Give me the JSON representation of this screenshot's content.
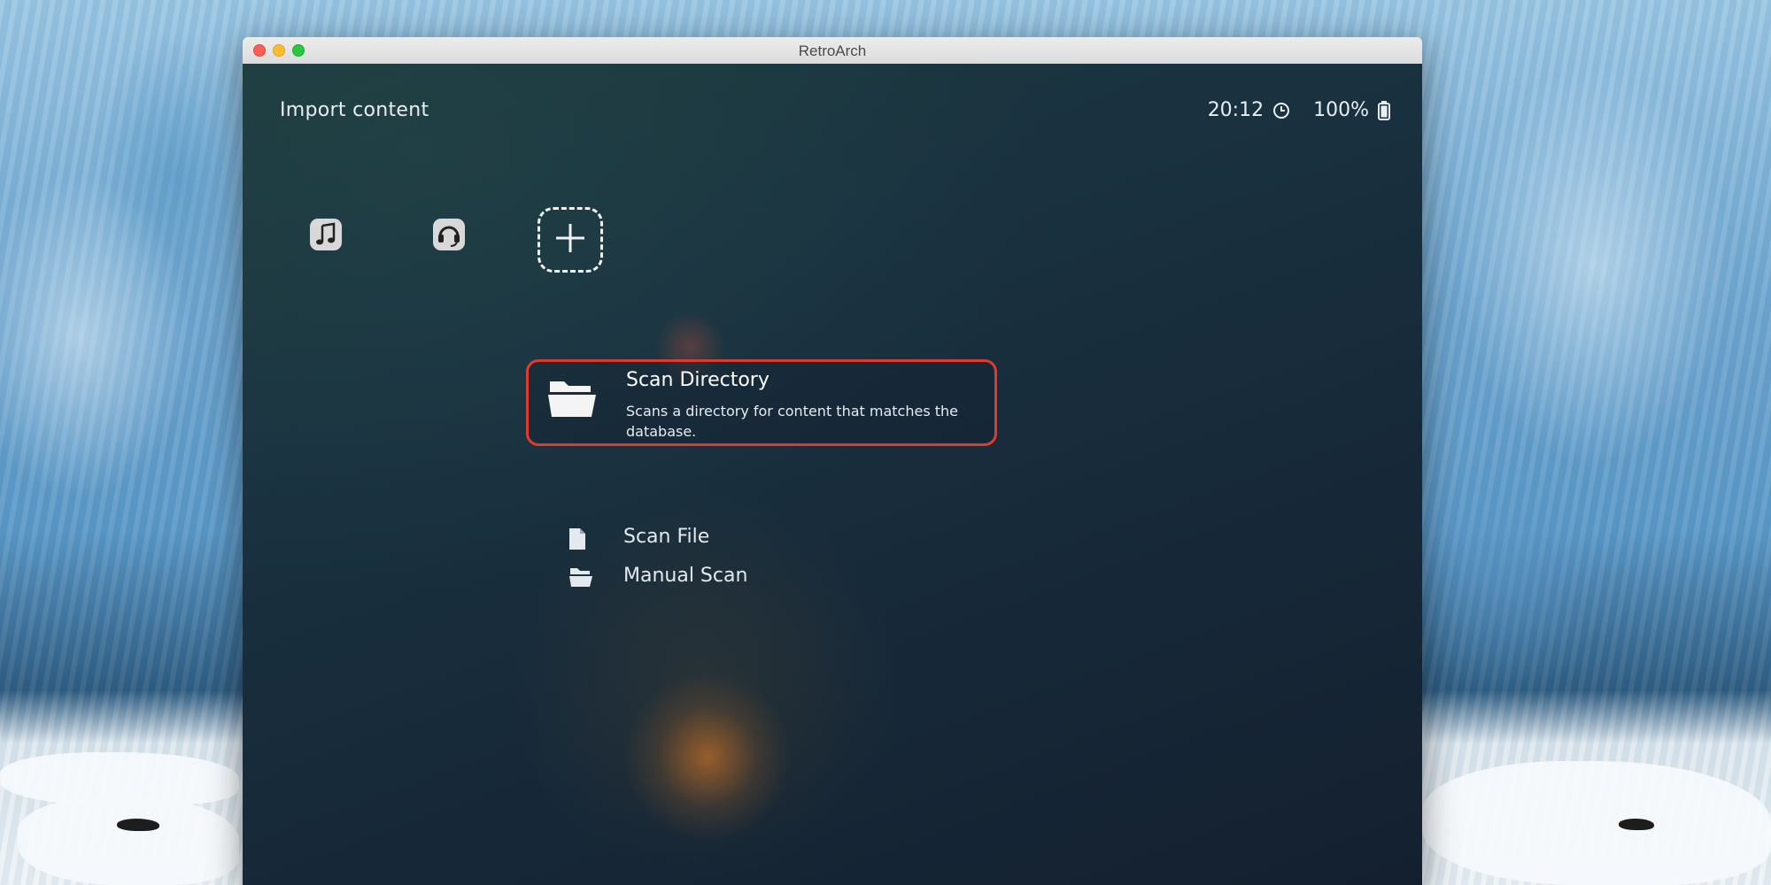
{
  "window": {
    "title": "RetroArch"
  },
  "header": {
    "title": "Import content",
    "time": "20:12",
    "battery": "100%"
  },
  "categories": [
    {
      "icon": "music-note-icon"
    },
    {
      "icon": "headset-icon"
    },
    {
      "icon": "add-icon",
      "selected": true
    }
  ],
  "menu": {
    "items": [
      {
        "label": "Scan Directory",
        "description": "Scans a directory for content that matches the database.",
        "icon": "folder-open-icon",
        "selected": true
      },
      {
        "label": "Scan File",
        "icon": "file-icon"
      },
      {
        "label": "Manual Scan",
        "icon": "folder-open-icon"
      }
    ]
  },
  "colors": {
    "selection_border": "#e03a2c",
    "background": "#172a3a",
    "text": "#ffffff"
  }
}
